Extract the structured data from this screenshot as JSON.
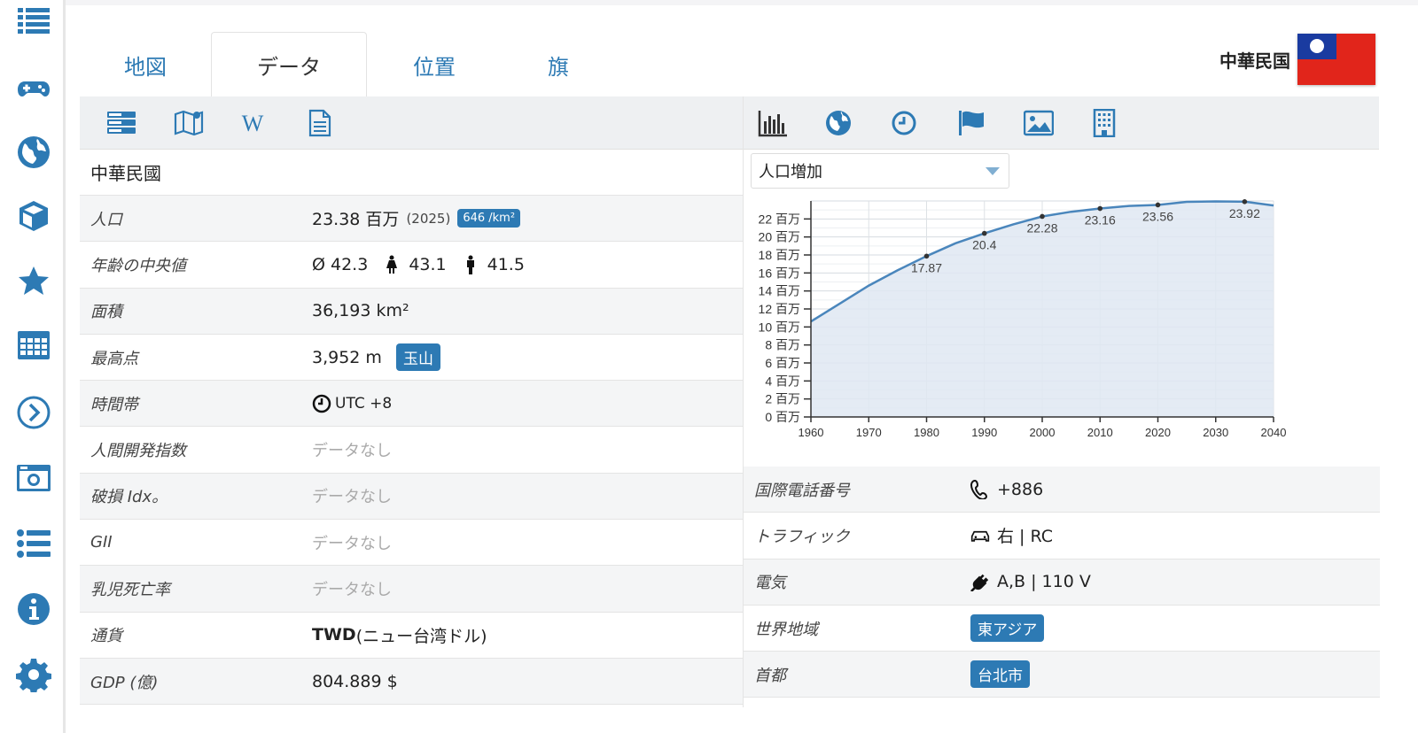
{
  "tabs": [
    {
      "label": "地図"
    },
    {
      "label": "データ"
    },
    {
      "label": "位置"
    },
    {
      "label": "旗"
    }
  ],
  "country": {
    "name": "中華民国"
  },
  "left": {
    "native_name": "中華民國",
    "rows": [
      {
        "label": "人口",
        "value": "23.38 百万",
        "year": "(2025)",
        "density": "646 /km²"
      },
      {
        "label": "年齢の中央値",
        "avg": "Ø 42.3",
        "female": "43.1",
        "male": "41.5"
      },
      {
        "label": "面積",
        "value": "36,193 km²"
      },
      {
        "label": "最高点",
        "value": "3,952 m",
        "peak": "玉山"
      },
      {
        "label": "時間帯",
        "value": "UTC +8"
      },
      {
        "label": "人間開発指数",
        "value": "データなし"
      },
      {
        "label": "破損 Idx。",
        "value": "データなし"
      },
      {
        "label": "GII",
        "value": "データなし"
      },
      {
        "label": "乳児死亡率",
        "value": "データなし"
      },
      {
        "label": "通貨",
        "code": "TWD",
        "name": " (ニュー台湾ドル)"
      },
      {
        "label": "GDP (億)",
        "value": "804.889 $"
      }
    ]
  },
  "right": {
    "select_label": "人口増加",
    "rows": [
      {
        "label": "国際電話番号",
        "value": "+886"
      },
      {
        "label": "トラフィック",
        "value": "右 | RC"
      },
      {
        "label": "電気",
        "value": "A,B | 110 V"
      },
      {
        "label": "世界地域",
        "value": "東アジア"
      },
      {
        "label": "首都",
        "value": "台北市"
      }
    ]
  },
  "icons": {
    "sidebar": [
      "list-icon",
      "gamepad-icon",
      "globe-icon",
      "cube-icon",
      "star-icon",
      "calendar-icon",
      "chevron-circle-icon",
      "camera-icon",
      "bullet-list-icon",
      "info-icon",
      "gear-icon"
    ],
    "left_bar": [
      "server-icon",
      "map-icon",
      "wikipedia-icon",
      "document-icon"
    ],
    "right_bar": [
      "bar-chart-icon",
      "globe-icon",
      "clock-icon",
      "flag-icon",
      "image-icon",
      "building-icon"
    ]
  },
  "colors": {
    "accent": "#2d7ab4",
    "area_fill": "#dfe8f2",
    "line": "#4a86bc"
  },
  "chart_data": {
    "type": "area",
    "x": [
      1960,
      1965,
      1970,
      1975,
      1980,
      1985,
      1990,
      1995,
      2000,
      2005,
      2010,
      2015,
      2020,
      2025,
      2030,
      2035,
      2040
    ],
    "values": [
      10.6,
      12.6,
      14.6,
      16.3,
      17.87,
      19.3,
      20.4,
      21.4,
      22.28,
      22.8,
      23.16,
      23.45,
      23.56,
      23.9,
      23.95,
      23.92,
      23.5
    ],
    "labeled_points": [
      {
        "x": 1980,
        "label": "17.87"
      },
      {
        "x": 1990,
        "label": "20.4"
      },
      {
        "x": 2000,
        "label": "22.28"
      },
      {
        "x": 2010,
        "label": "23.16"
      },
      {
        "x": 2020,
        "label": "23.56"
      },
      {
        "x": 2035,
        "label": "23.92"
      }
    ],
    "xlim": [
      1960,
      2040
    ],
    "ylim": [
      0,
      24
    ],
    "xticks": [
      "1960",
      "1970",
      "1980",
      "1990",
      "2000",
      "2010",
      "2020",
      "2030",
      "2040"
    ],
    "yticks": [
      "0 百万",
      "2 百万",
      "4 百万",
      "6 百万",
      "8 百万",
      "10 百万",
      "12 百万",
      "14 百万",
      "16 百万",
      "18 百万",
      "20 百万",
      "22 百万"
    ],
    "grid": true
  }
}
